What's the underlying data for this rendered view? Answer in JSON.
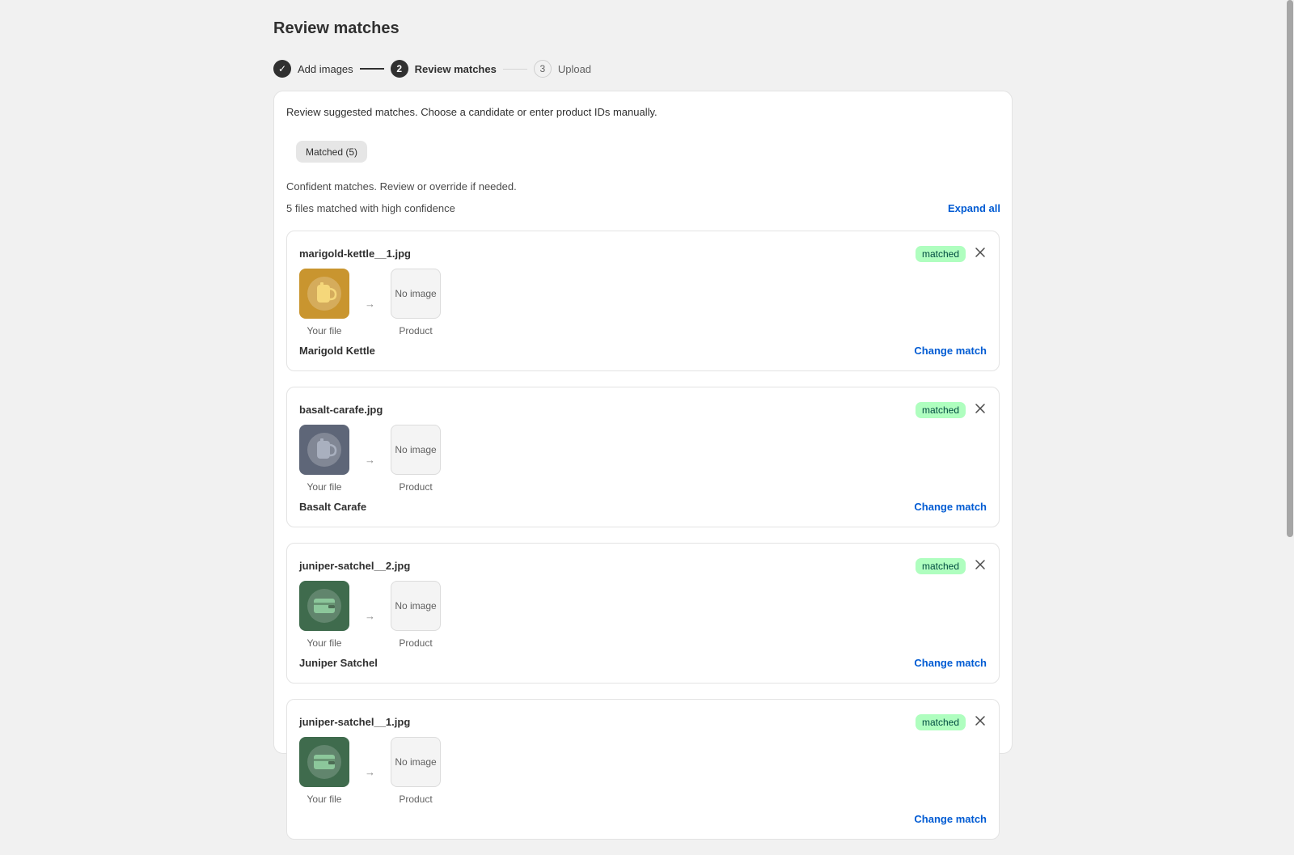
{
  "page": {
    "title": "Review matches"
  },
  "stepper": {
    "steps": [
      {
        "label": "Add images",
        "state": "done",
        "marker": "✓"
      },
      {
        "label": "Review matches",
        "state": "current",
        "marker": "2"
      },
      {
        "label": "Upload",
        "state": "future",
        "marker": "3"
      }
    ]
  },
  "card": {
    "intro": "Review suggested matches. Choose a candidate or enter product IDs manually.",
    "tab_label": "Matched (5)",
    "description": "Confident matches. Review or override if needed.",
    "count_text": "5 files matched with high confidence",
    "expand_all": "Expand all"
  },
  "labels": {
    "your_file": "Your file",
    "product": "Product",
    "no_image": "No image",
    "change_match": "Change match",
    "arrow": "→"
  },
  "matches": [
    {
      "file_name": "marigold-kettle__1.jpg",
      "status": "matched",
      "product_name": "Marigold Kettle",
      "thumb_icon": "mug-icon",
      "thumb_color": "#c9952f",
      "icon_color": "#f5d77a"
    },
    {
      "file_name": "basalt-carafe.jpg",
      "status": "matched",
      "product_name": "Basalt Carafe",
      "thumb_icon": "mug-icon",
      "thumb_color": "#5e6678",
      "icon_color": "#a9b0bf"
    },
    {
      "file_name": "juniper-satchel__2.jpg",
      "status": "matched",
      "product_name": "Juniper Satchel",
      "thumb_icon": "bag-icon",
      "thumb_color": "#3f6b4d",
      "icon_color": "#8cc79b"
    },
    {
      "file_name": "juniper-satchel__1.jpg",
      "status": "matched",
      "product_name": "",
      "thumb_icon": "bag-icon",
      "thumb_color": "#3f6b4d",
      "icon_color": "#8cc79b"
    }
  ],
  "colors": {
    "accent": "#005bd3",
    "badge_bg": "#affebf",
    "badge_text": "#014b40"
  }
}
